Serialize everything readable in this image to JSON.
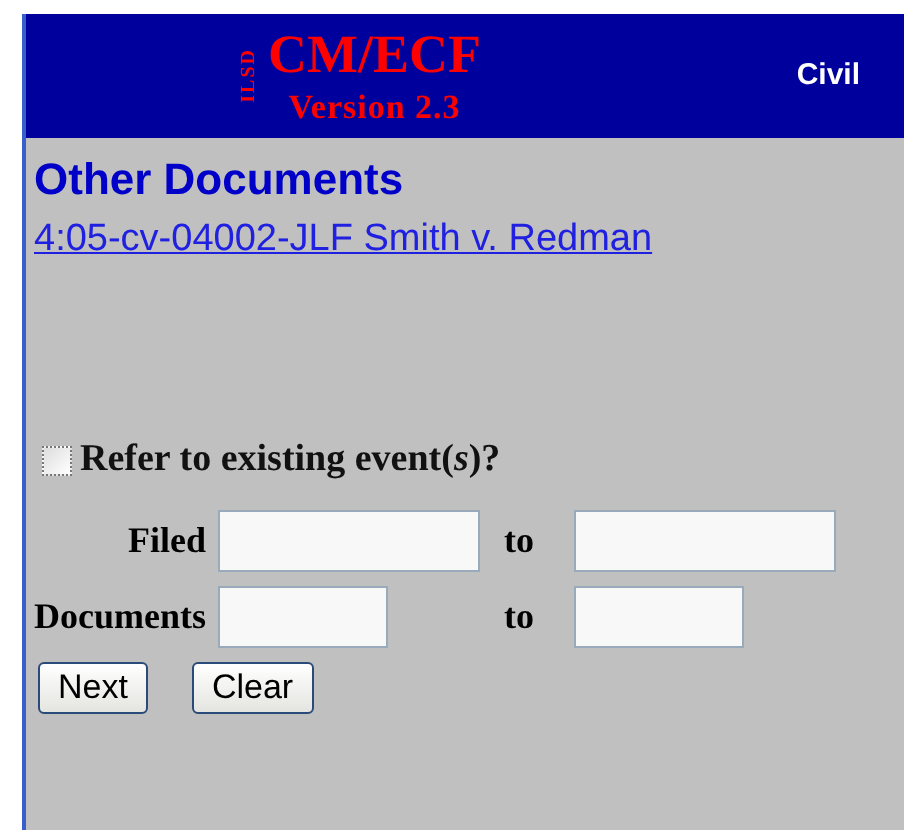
{
  "header": {
    "court": "ILSD",
    "logo": "CM/ECF",
    "version": "Version 2.3",
    "mode": "Civil"
  },
  "page_title": "Other Documents",
  "case_link": "4:05-cv-04002-JLF Smith v. Redman",
  "refer_checkbox": {
    "label": "Refer to existing event(*s*)?",
    "checked": false
  },
  "ranges": [
    {
      "label": "Filed",
      "to": "to",
      "kind": "wide"
    },
    {
      "label": "Documents",
      "to": "to",
      "kind": "narrow"
    }
  ],
  "buttons": [
    "Next",
    "Clear"
  ]
}
